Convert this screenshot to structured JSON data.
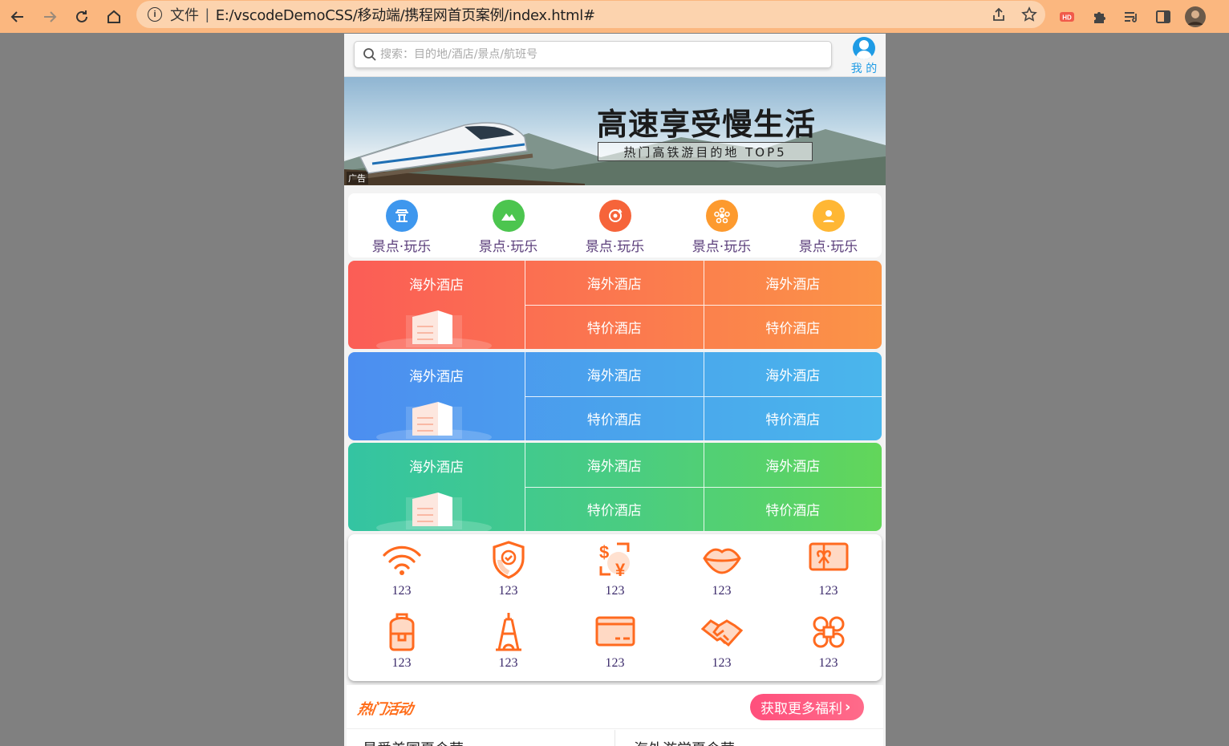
{
  "browser": {
    "scheme_label": "文件",
    "separator": "|",
    "url": "E:/vscodeDemoCSS/移动端/携程网首页案例/index.html#"
  },
  "header": {
    "search_placeholder": "搜索：目的地/酒店/景点/航班号",
    "user_label": "我 的"
  },
  "banner": {
    "title": "高速享受慢生活",
    "subtitle": "热门高铁游目的地 TOP5",
    "ad_label": "广告"
  },
  "nav": {
    "items": [
      {
        "label": "景点·玩乐",
        "icon": "temple-icon",
        "color": "#3e97ee"
      },
      {
        "label": "景点·玩乐",
        "icon": "mountain-icon",
        "color": "#4cc54f"
      },
      {
        "label": "景点·玩乐",
        "icon": "refresh-icon",
        "color": "#f6643a"
      },
      {
        "label": "景点·玩乐",
        "icon": "flower-icon",
        "color": "#fd9a2e"
      },
      {
        "label": "景点·玩乐",
        "icon": "location-icon",
        "color": "#ffb734"
      }
    ]
  },
  "grid": {
    "rows": [
      {
        "big": "海外酒店",
        "col1": [
          "海外酒店",
          "特价酒店"
        ],
        "col2": [
          "海外酒店",
          "特价酒店"
        ]
      },
      {
        "big": "海外酒店",
        "col1": [
          "海外酒店",
          "特价酒店"
        ],
        "col2": [
          "海外酒店",
          "特价酒店"
        ]
      },
      {
        "big": "海外酒店",
        "col1": [
          "海外酒店",
          "特价酒店"
        ],
        "col2": [
          "海外酒店",
          "特价酒店"
        ]
      }
    ]
  },
  "services": {
    "row1": [
      {
        "label": "123",
        "icon": "wifi-icon"
      },
      {
        "label": "123",
        "icon": "shield-icon"
      },
      {
        "label": "123",
        "icon": "currency-exchange-icon"
      },
      {
        "label": "123",
        "icon": "lips-icon"
      },
      {
        "label": "123",
        "icon": "gift-card-icon"
      }
    ],
    "row2": [
      {
        "label": "123",
        "icon": "backpack-icon"
      },
      {
        "label": "123",
        "icon": "eiffel-tower-icon"
      },
      {
        "label": "123",
        "icon": "card-icon"
      },
      {
        "label": "123",
        "icon": "handshake-icon"
      },
      {
        "label": "123",
        "icon": "apps-icon"
      }
    ],
    "icon_color": "#ff6a1f"
  },
  "hot": {
    "title": "热门活动",
    "button_label": "获取更多福利",
    "sub_left": "最爱美国夏令营",
    "sub_right": "海外游学夏令营"
  }
}
